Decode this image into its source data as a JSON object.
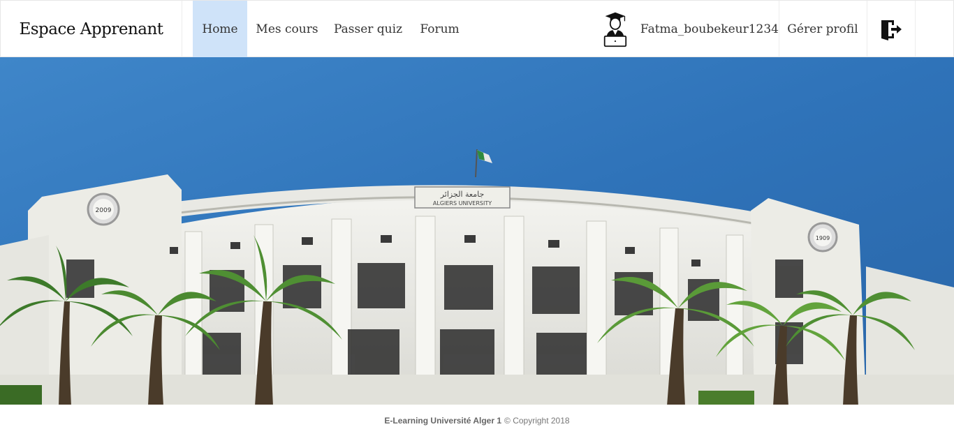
{
  "brand": {
    "title": "Espace Apprenant"
  },
  "nav": {
    "items": [
      {
        "label": "Home",
        "active": true
      },
      {
        "label": "Mes cours",
        "active": false
      },
      {
        "label": "Passer quiz",
        "active": false
      },
      {
        "label": "Forum",
        "active": false
      }
    ],
    "active_color": "#cfe3f9"
  },
  "user": {
    "username": "Fatma_boubekeur1234",
    "avatar_icon": "graduate-laptop-icon"
  },
  "profile": {
    "label": "Gérer profil"
  },
  "logout": {
    "icon": "logout-icon"
  },
  "hero": {
    "sign_arabic": "جامعة الجزائر",
    "sign_english": "ALGIERS UNIVERSITY",
    "year_left": "2009",
    "year_right": "1909",
    "sky_color": "#2f73b9"
  },
  "footer": {
    "org": "E-Learning Université Alger 1",
    "copyright": "© Copyright 2018"
  }
}
